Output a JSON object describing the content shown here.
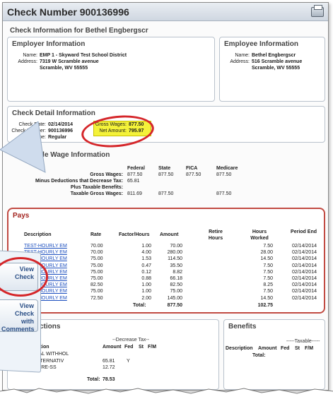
{
  "window": {
    "title": "Check Number 900136996"
  },
  "check_info": {
    "heading": "Check Information for Bethel Engbergscr"
  },
  "employer": {
    "heading": "Employer Information",
    "name_label": "Name:",
    "name": "EMP 1 - Skyward Test School District",
    "address_label": "Address:",
    "address1": "7319 W Scramble avenue",
    "address2": "Scramble, WV 55555"
  },
  "employee": {
    "heading": "Employee Information",
    "name_label": "Name:",
    "name": "Bethel Engbergscr",
    "address_label": "Address:",
    "address1": "516 Scramble avenue",
    "address2": "Scramble, WV 55555"
  },
  "detail": {
    "heading": "Check Detail Information",
    "check_date_label": "Check Date:",
    "check_date": "02/14/2014",
    "check_number_label": "Check Number:",
    "check_number": "900136996",
    "check_type_label": "Check Type:",
    "check_type": "Regular",
    "gross_label": "Gross Wages:",
    "gross": "877.50",
    "net_label": "Net Amount:",
    "net": "795.97"
  },
  "taxable": {
    "heading": "Taxable Wage Information",
    "columns": [
      "Federal",
      "State",
      "FICA",
      "Medicare"
    ],
    "rows": [
      {
        "label": "Gross Wages:",
        "federal": "877.50",
        "state": "877.50",
        "fica": "877.50",
        "medicare": "877.50"
      },
      {
        "label": "Minus Deductions that Decrease Tax:",
        "federal": "65.81",
        "state": "",
        "fica": "",
        "medicare": ""
      },
      {
        "label": "Plus Taxable Benefits:",
        "federal": "",
        "state": "",
        "fica": "",
        "medicare": ""
      },
      {
        "label": "Taxable Gross Wages:",
        "federal": "811.69",
        "state": "877.50",
        "fica": "",
        "medicare": "877.50"
      }
    ]
  },
  "pays": {
    "heading": "Pays",
    "columns": {
      "description": "Description",
      "rate": "Rate",
      "factor": "Factor/Hours",
      "amount": "Amount",
      "retire": "Retire Hours",
      "hours": "Hours Worked",
      "period": "Period End"
    },
    "rows": [
      {
        "desc": "TEST-HOURLY EM",
        "rate": "70.00",
        "factor": "1.00",
        "amount": "70.00",
        "hours": "7.50",
        "period": "02/14/2014"
      },
      {
        "desc": "TEST-HOURLY EM",
        "rate": "70.00",
        "factor": "4.00",
        "amount": "280.00",
        "hours": "28.00",
        "period": "02/14/2014"
      },
      {
        "desc": "TEST-HOURLY EM",
        "rate": "75.00",
        "factor": "1.53",
        "amount": "114.50",
        "hours": "14.50",
        "period": "02/14/2014"
      },
      {
        "desc": "TEST-HOURLY EM",
        "rate": "75.00",
        "factor": "0.47",
        "amount": "35.50",
        "hours": "7.50",
        "period": "02/14/2014"
      },
      {
        "desc": "TEST-HOURLY EM",
        "rate": "75.00",
        "factor": "0.12",
        "amount": "8.82",
        "hours": "7.50",
        "period": "02/14/2014"
      },
      {
        "desc": "TEST-HOURLY EM",
        "rate": "75.00",
        "factor": "0.88",
        "amount": "66.18",
        "hours": "7.50",
        "period": "02/14/2014"
      },
      {
        "desc": "TEST-HOURLY EM",
        "rate": "82.50",
        "factor": "1.00",
        "amount": "82.50",
        "hours": "8.25",
        "period": "02/14/2014"
      },
      {
        "desc": "TEST-HOURLY EM",
        "rate": "75.00",
        "factor": "1.00",
        "amount": "75.00",
        "hours": "7.50",
        "period": "02/14/2014"
      },
      {
        "desc": "TEST-HOURLY EM",
        "rate": "72.50",
        "factor": "2.00",
        "amount": "145.00",
        "hours": "14.50",
        "period": "02/14/2014"
      }
    ],
    "total_label": "Total:",
    "total_amount": "877.50",
    "total_hours": "102.75"
  },
  "deductions": {
    "heading": "Deductions",
    "decrease_tax": "--Decrease Tax--",
    "col_desc": "Description",
    "col_amount": "Amount",
    "col_fed": "Fed",
    "col_st": "St",
    "col_fm": "F/M",
    "rows": [
      {
        "desc": "FEDERAL WITHHOL",
        "amount": "",
        "fed": ""
      },
      {
        "desc": "FICA ALTERNATIV",
        "amount": "65.81",
        "fed": "Y"
      },
      {
        "desc": "MEDICARE-SS",
        "amount": "12.72",
        "fed": ""
      }
    ],
    "total_label": "Total:",
    "total": "78.53"
  },
  "benefits": {
    "heading": "Benefits",
    "taxable": "-----Taxable-----",
    "col_desc": "Description",
    "col_amount": "Amount",
    "col_fed": "Fed",
    "col_st": "St",
    "col_fm": "F/M",
    "total_label": "Total:"
  },
  "callout": {
    "btn1_line1": "View",
    "btn1_line2": "Check",
    "btn2_line1": "View",
    "btn2_line2": "Check with",
    "btn2_line3": "Comments"
  }
}
